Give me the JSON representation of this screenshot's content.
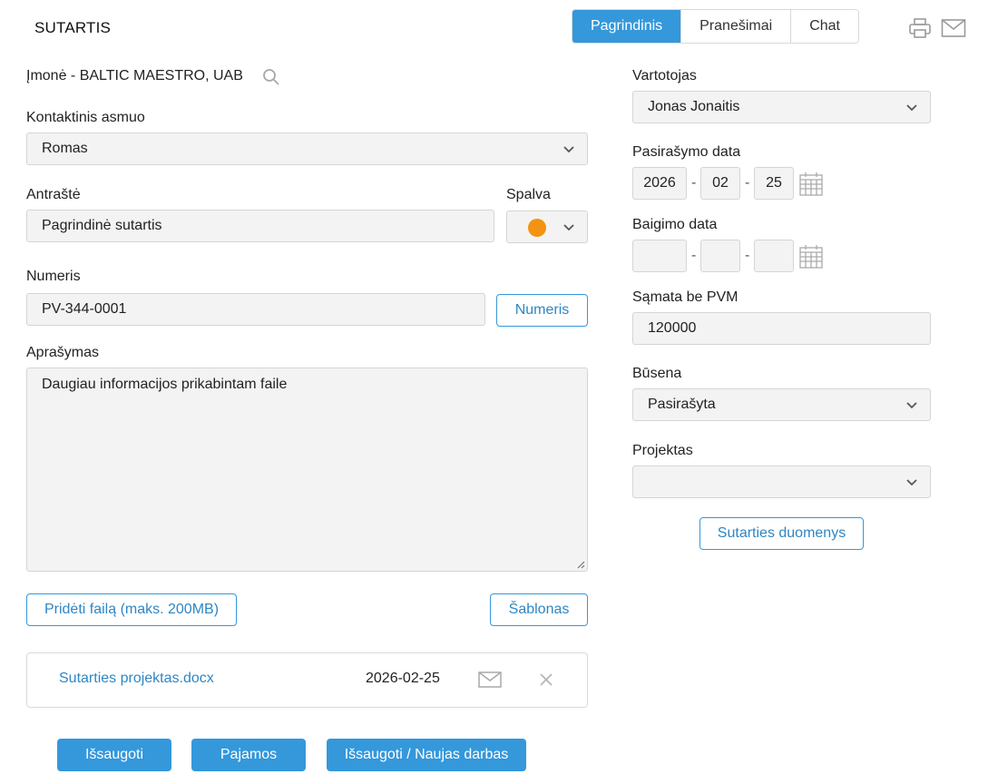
{
  "header": {
    "title": "SUTARTIS",
    "tabs": [
      {
        "label": "Pagrindinis",
        "active": true
      },
      {
        "label": "Pranešimai",
        "active": false
      },
      {
        "label": "Chat",
        "active": false
      }
    ],
    "icons": [
      "print-icon",
      "mail-icon"
    ]
  },
  "left": {
    "company_prefix": "Įmonė -",
    "company_name": "BALTIC MAESTRO, UAB",
    "contact_label": "Kontaktinis asmuo",
    "contact_value": "Romas",
    "heading_label": "Antraštė",
    "heading_value": "Pagrindinė sutartis",
    "color_label": "Spalva",
    "color_value": "#f39312",
    "number_label": "Numeris",
    "number_value": "PV-344-0001",
    "number_button": "Numeris",
    "description_label": "Aprašymas",
    "description_value": "Daugiau informacijos prikabintam faile",
    "add_file_button": "Pridėti failą (maks. 200MB)",
    "templates_button": "Šablonas"
  },
  "files": [
    {
      "name": "Sutarties projektas.docx",
      "date": "2026-02-25"
    }
  ],
  "actions": {
    "save": "Išsaugoti",
    "income": "Pajamos",
    "save_new": "Išsaugoti / Naujas darbas"
  },
  "right": {
    "user_label": "Vartotojas",
    "user_value": "Jonas Jonaitis",
    "sign_date_label": "Pasirašymo data",
    "sign_date": {
      "year": "2026",
      "month": "02",
      "day": "25"
    },
    "end_date_label": "Baigimo data",
    "end_date": {
      "year": "",
      "month": "",
      "day": ""
    },
    "estimate_label": "Sąmata be PVM",
    "estimate_value": "120000",
    "status_label": "Būsena",
    "status_value": "Pasirašyta",
    "project_label": "Projektas",
    "project_value": "",
    "contract_data_button": "Sutarties duomenys"
  },
  "colors": {
    "accent": "#3498db",
    "link": "#2f86c4",
    "field_bg": "#f3f3f3",
    "border": "#d5d5d5"
  }
}
